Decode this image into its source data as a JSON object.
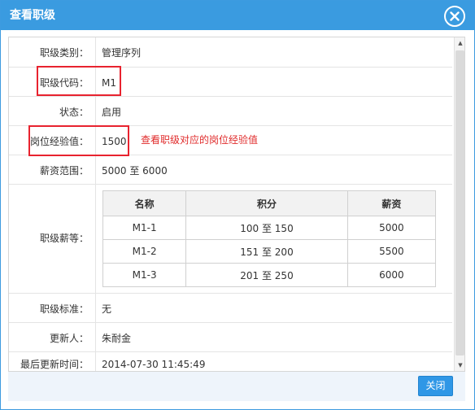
{
  "dialog": {
    "title": "查看职级",
    "close_icon": "close-icon"
  },
  "fields": {
    "category": {
      "label": "职级类别：",
      "value": "管理序列"
    },
    "code": {
      "label": "职级代码：",
      "value": "M1"
    },
    "status": {
      "label": "状态：",
      "value": "启用"
    },
    "experience": {
      "label": "岗位经验值：",
      "value": "1500",
      "note": "查看职级对应的岗位经验值"
    },
    "salary_range": {
      "label": "薪资范围：",
      "value": "5000 至 6000"
    },
    "rank_salary": {
      "label": "职级薪等："
    },
    "standard": {
      "label": "职级标准：",
      "value": "无"
    },
    "updater": {
      "label": "更新人：",
      "value": "朱耐金"
    },
    "updated_at": {
      "label": "最后更新时间：",
      "value": "2014-07-30 11:45:49"
    }
  },
  "rank_table": {
    "headers": [
      "名称",
      "积分",
      "薪资"
    ],
    "rows": [
      [
        "M1-1",
        "100 至 150",
        "5000"
      ],
      [
        "M1-2",
        "151 至 200",
        "5500"
      ],
      [
        "M1-3",
        "201 至 250",
        "6000"
      ]
    ]
  },
  "footer": {
    "close_label": "关闭"
  },
  "colors": {
    "titlebar": "#3a9be0",
    "highlight_border": "#e8232f",
    "note_text": "#e02b2b",
    "button": "#2f97e6"
  }
}
